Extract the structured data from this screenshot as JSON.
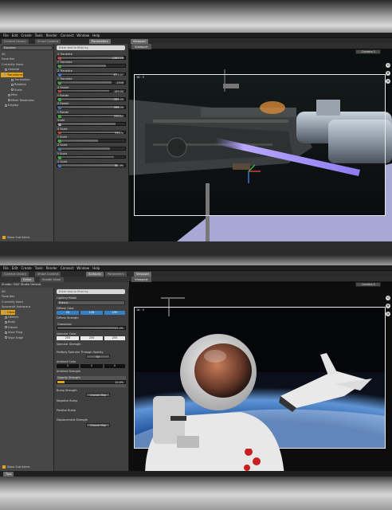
{
  "menu": [
    "File",
    "Edit",
    "Create",
    "Tools",
    "Render",
    "Connect",
    "Window",
    "Help"
  ],
  "shot1": {
    "tabs": [
      "Content Library",
      "Smart Content",
      "Parameters"
    ],
    "explorer_dropdown": "Explorer",
    "tree": [
      {
        "label": "All",
        "indent": 0,
        "sel": false
      },
      {
        "label": "Favorites",
        "indent": 0,
        "sel": false
      },
      {
        "label": "Currently Used",
        "indent": 0,
        "sel": false
      },
      {
        "label": "General",
        "indent": 1,
        "sel": false
      },
      {
        "label": "Transforms",
        "indent": 1,
        "sel": true
      },
      {
        "label": "Translation",
        "indent": 3,
        "sel": false
      },
      {
        "label": "Rotation",
        "indent": 3,
        "sel": false
      },
      {
        "label": "Scale",
        "indent": 3,
        "sel": false
      },
      {
        "label": "Misc",
        "indent": 2,
        "sel": false
      },
      {
        "label": "Mesh Resolution",
        "indent": 2,
        "sel": false
      },
      {
        "label": "Display",
        "indent": 1,
        "sel": false
      }
    ],
    "show_sub_items": "Show Sub Items",
    "search_placeholder": "Enter text to filter by",
    "params": [
      {
        "label": "X Translate",
        "value": "-1387.75",
        "level": 0.98,
        "color": "#c8463c"
      },
      {
        "label": "Y Translate",
        "value": "",
        "level": 0.72,
        "color": "#3fae3f"
      },
      {
        "label": "Z Translate",
        "value": "-675.07",
        "level": 0.88,
        "color": "#3f74c8"
      },
      {
        "label": "Y Translate",
        "value": "-2448",
        "level": 0.8,
        "color": "#3fae3f"
      },
      {
        "label": "X Rotate",
        "value": "-169.00",
        "level": 0.76,
        "color": "#c8463c"
      },
      {
        "label": "Y Rotate",
        "value": "-329.00",
        "level": 0.9,
        "color": "#3fae3f"
      },
      {
        "label": "Z Rotate",
        "value": "290.00",
        "level": 0.92,
        "color": "#3f74c8"
      },
      {
        "label": "Y Rotate",
        "value": "290.00",
        "level": 0.94,
        "color": "#3fae3f"
      },
      {
        "label": "Scale",
        "value": "",
        "level": 0.86,
        "color": "#aaaaaa"
      },
      {
        "label": "X Scale",
        "value": "93.1%",
        "level": 0.93,
        "color": "#c8463c"
      },
      {
        "label": "Y Scale",
        "value": "",
        "level": 0.6,
        "color": "#3fae3f"
      },
      {
        "label": "Z Scale",
        "value": "",
        "level": 0.78,
        "color": "#3f74c8"
      },
      {
        "label": "Y Scale",
        "value": "",
        "level": 0.84,
        "color": "#3fae3f"
      },
      {
        "label": "Z Scale",
        "value": "88.0%",
        "level": 0.88,
        "color": "#3f74c8"
      }
    ],
    "viewport_tab": "Viewport",
    "camera": "Camera 1",
    "aspect": "16 : 9"
  },
  "shot2": {
    "tabs": [
      "Content Library",
      "Smart Content",
      "Surfaces",
      "Parameters"
    ],
    "sub_tabs": [
      "Editor",
      "Shader Mixer"
    ],
    "shader_name": "Shader: DAZ Studio Default",
    "tree": [
      {
        "label": "All",
        "indent": 0,
        "sel": false
      },
      {
        "label": "Favorites",
        "indent": 0,
        "sel": false
      },
      {
        "label": "Currently Used",
        "indent": 0,
        "sel": false
      },
      {
        "label": "Spacesuit Astronaut",
        "indent": 0,
        "sel": false
      },
      {
        "label": "Glass",
        "indent": 1,
        "sel": true
      },
      {
        "label": "Helmet",
        "indent": 1,
        "sel": false
      },
      {
        "label": "Body",
        "indent": 1,
        "sel": false
      },
      {
        "label": "Gloves",
        "indent": 1,
        "sel": false
      },
      {
        "label": "Visor Ring",
        "indent": 1,
        "sel": false
      },
      {
        "label": "Visor Edge",
        "indent": 1,
        "sel": false
      }
    ],
    "show_sub_items": "Show Sub Items",
    "search_placeholder": "Enter text to filter by",
    "lighting_model_label": "Lighting Model",
    "lighting_model_value": "Plastic",
    "diffuse_color_label": "Diffuse Color",
    "diffuse_rgb": [
      "54",
      "128",
      "195"
    ],
    "diffuse_strength_label": "Diffuse Strength",
    "glossiness_label": "Glossiness",
    "glossiness_value": "85.0%",
    "specular_color_label": "Specular Color",
    "specular_rgb": [
      "255",
      "255",
      "255"
    ],
    "specular_strength_label": "Specular Strength",
    "multiply_specular_label": "Multiply Specular Through Opacity",
    "multiply_specular_value": "On",
    "ambient_color_label": "Ambient Color",
    "ambient_rgb": [
      "0",
      "0",
      "0"
    ],
    "ambient_strength_label": "Ambient Strength",
    "opacity_label": "Opacity Strength",
    "opacity_value": "10.0%",
    "bump_label": "Bump Strength",
    "choose_map": "Choose Map",
    "negative_bump_label": "Negative Bump",
    "positive_bump_label": "Positive Bump",
    "displacement_label": "Displacement Strength",
    "viewport_tab": "Viewport",
    "camera": "Camera 1",
    "aspect": "16 : 9",
    "tips": "Tips"
  }
}
